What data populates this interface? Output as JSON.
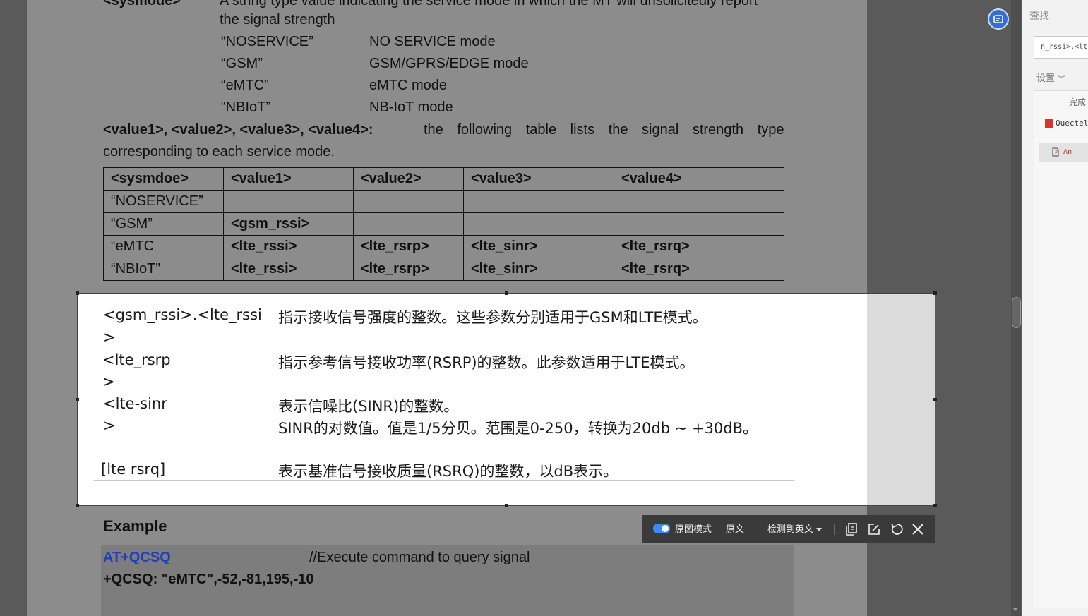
{
  "document": {
    "sysmode_label": "<sysmode>",
    "sysmode_desc_1": "A string type value indicating the service mode in which the MT will unsolicitedly report",
    "sysmode_desc_2": "the signal strength",
    "modes": [
      {
        "name": "“NOSERVICE”",
        "desc": "NO SERVICE mode"
      },
      {
        "name": "“GSM”",
        "desc": "GSM/GPRS/EDGE mode"
      },
      {
        "name": "“eMTC”",
        "desc": "eMTC mode"
      },
      {
        "name": "“NBIoT”",
        "desc": "NB-IoT mode"
      }
    ],
    "values_label": "<value1>, <value2>, <value3>, <value4>:",
    "values_desc_1": "the following table lists the signal strength type",
    "values_desc_2": "corresponding to each service mode.",
    "table": {
      "headers": [
        "<sysmdoe>",
        "<value1>",
        "<value2>",
        "<value3>",
        "<value4>"
      ],
      "rows": [
        [
          "“NOSERVICE”",
          "",
          "",
          "",
          ""
        ],
        [
          "“GSM”",
          "<gsm_rssi>",
          "",
          "",
          ""
        ],
        [
          "“eMTC",
          "<lte_rssi>",
          "<lte_rsrp>",
          "<lte_sinr>",
          "<lte_rsrq>"
        ],
        [
          "“NBIoT”",
          "<lte_rssi>",
          "<lte_rsrp>",
          "<lte_sinr>",
          "<lte_rsrq>"
        ]
      ]
    },
    "example_title": "Example",
    "example_cmd": "AT+QCSQ",
    "example_comment": "//Execute command to query signal",
    "example_resp": "+QCSQ: \"eMTC\",-52,-81,195,-10"
  },
  "translation": {
    "lines": [
      {
        "param": "<gsm_rssi>.<lte_rssi",
        "desc": "指示接收信号强度的整数。这些参数分别适用于GSM和LTE模式。"
      },
      {
        "param": ">",
        "desc": ""
      },
      {
        "param": "<lte_rsrp",
        "desc": "指示参考信号接收功率(RSRP)的整数。此参数适用于LTE模式。"
      },
      {
        "param": ">",
        "desc": ""
      },
      {
        "param": "<lte-sinr",
        "desc": "表示信噪比(SINR)的整数。"
      },
      {
        "param": ">",
        "desc": "SINR的对数值。值是1/5分贝。范围是0-250，转换为20db ~ +30dB。"
      },
      {
        "param": "[lte rsrq]",
        "desc": "表示基准信号接收质量(RSRQ)的整数，以dB表示。"
      }
    ]
  },
  "toolbar": {
    "original_image_mode": "原图模式",
    "original_text": "原文",
    "detect_language": "检测到英文",
    "icons": [
      "copy-icon",
      "edit-icon",
      "refresh-icon",
      "close-icon"
    ]
  },
  "side_panel": {
    "title": "查找",
    "search_value": "n_rssi>,<lte",
    "settings": "设置",
    "complete": "完成",
    "result_file": "Quectel",
    "result_snippet": ",> An"
  },
  "colors": {
    "accent": "#3d8af7",
    "example_cmd": "#1f3fbf",
    "toolbar_bg": "#3a3a3a"
  }
}
